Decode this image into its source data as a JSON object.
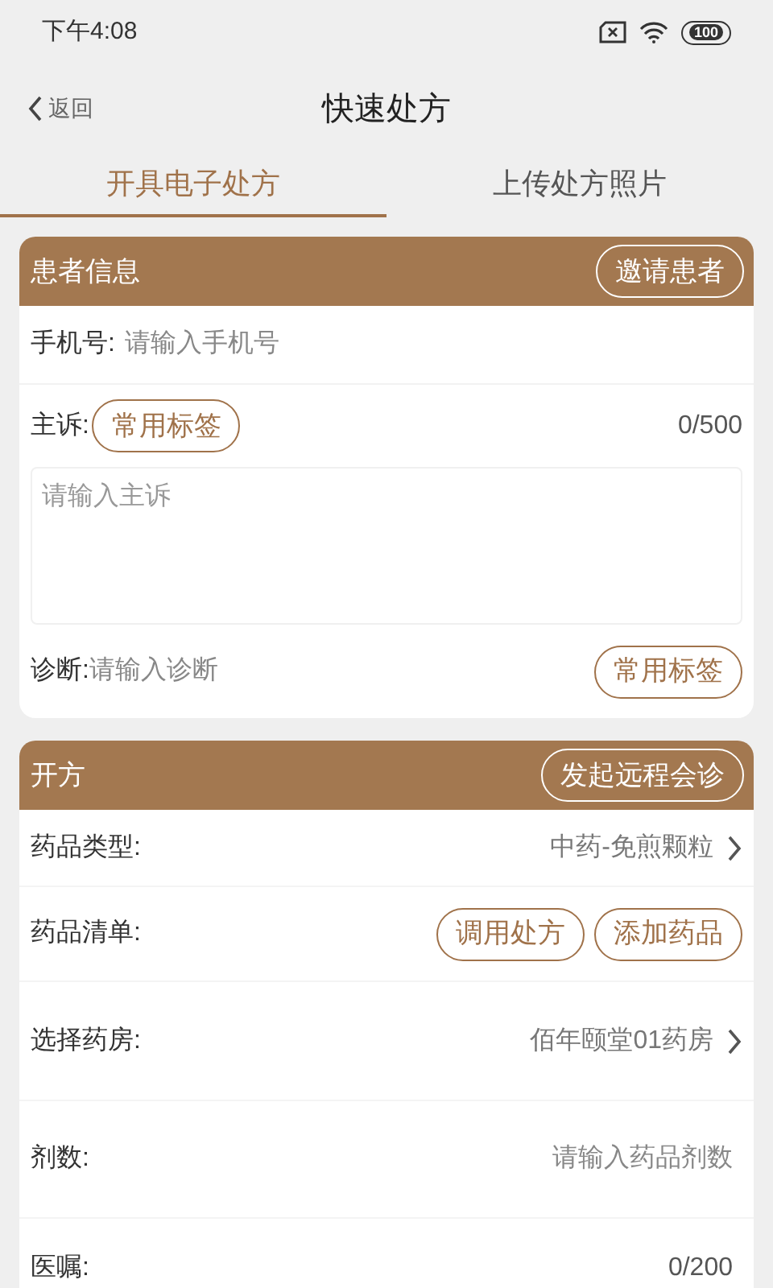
{
  "status_bar": {
    "time": "下午4:08",
    "battery": "100"
  },
  "nav": {
    "back": "返回",
    "title": "快速处方"
  },
  "tabs": [
    {
      "label": "开具电子处方",
      "selected": true
    },
    {
      "label": "上传处方照片",
      "selected": false
    }
  ],
  "patient_card": {
    "title": "患者信息",
    "invite_button": "邀请患者",
    "phone": {
      "label": "手机号:",
      "placeholder": "请输入手机号"
    },
    "complaint": {
      "label": "主诉:",
      "tag_button": "常用标签",
      "counter": "0/500",
      "placeholder": "请输入主诉"
    },
    "diagnosis": {
      "label": "诊断:",
      "placeholder": "请输入诊断",
      "tag_button": "常用标签"
    }
  },
  "prescription_card": {
    "title": "开方",
    "consult_button": "发起远程会诊",
    "rows": [
      {
        "kind": "select",
        "label": "药品类型:",
        "value": "中药-免煎颗粒"
      },
      {
        "kind": "buttons",
        "label": "药品清单:",
        "buttons": [
          "调用处方",
          "添加药品"
        ]
      },
      {
        "kind": "select",
        "label": "选择药房:",
        "value": "佰年颐堂01药房"
      },
      {
        "kind": "input",
        "label": "剂数:",
        "placeholder": "请输入药品剂数"
      },
      {
        "kind": "counter",
        "label": "医嘱:",
        "counter": "0/200"
      }
    ]
  }
}
